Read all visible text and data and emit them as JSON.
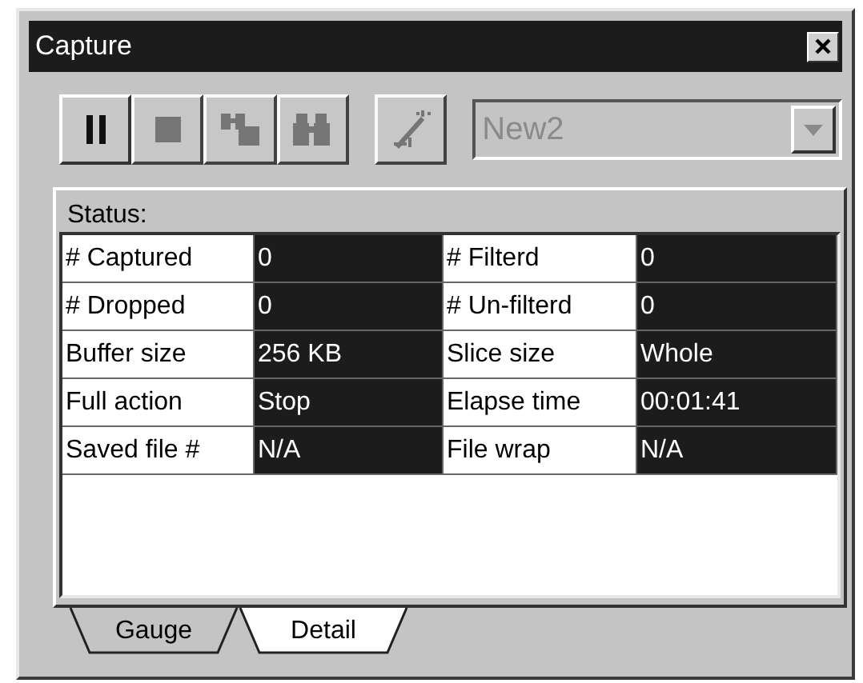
{
  "window": {
    "title": "Capture"
  },
  "toolbar": [
    {
      "kind": "pause",
      "disabled": false
    },
    {
      "kind": "stop",
      "disabled": true
    },
    {
      "kind": "find-next",
      "disabled": true
    },
    {
      "kind": "find",
      "disabled": true
    },
    {
      "kind": "wand",
      "disabled": true
    }
  ],
  "profile_dropdown": {
    "value": "New2",
    "disabled": true
  },
  "status": {
    "label": "Status:",
    "rows": [
      {
        "cells": [
          "# Captured",
          "0",
          "# Filterd",
          "0"
        ]
      },
      {
        "cells": [
          "# Dropped",
          "0",
          "# Un-filterd",
          "0"
        ]
      },
      {
        "cells": [
          "Buffer size",
          "256 KB",
          "Slice size",
          "Whole"
        ]
      },
      {
        "cells": [
          "Full action",
          "Stop",
          "Elapse time",
          "00:01:41"
        ]
      },
      {
        "cells": [
          "Saved file #",
          "N/A",
          "File wrap",
          "N/A"
        ]
      }
    ]
  },
  "tabs": [
    {
      "label": "Gauge",
      "selected": false
    },
    {
      "label": "Detail",
      "selected": true
    }
  ]
}
